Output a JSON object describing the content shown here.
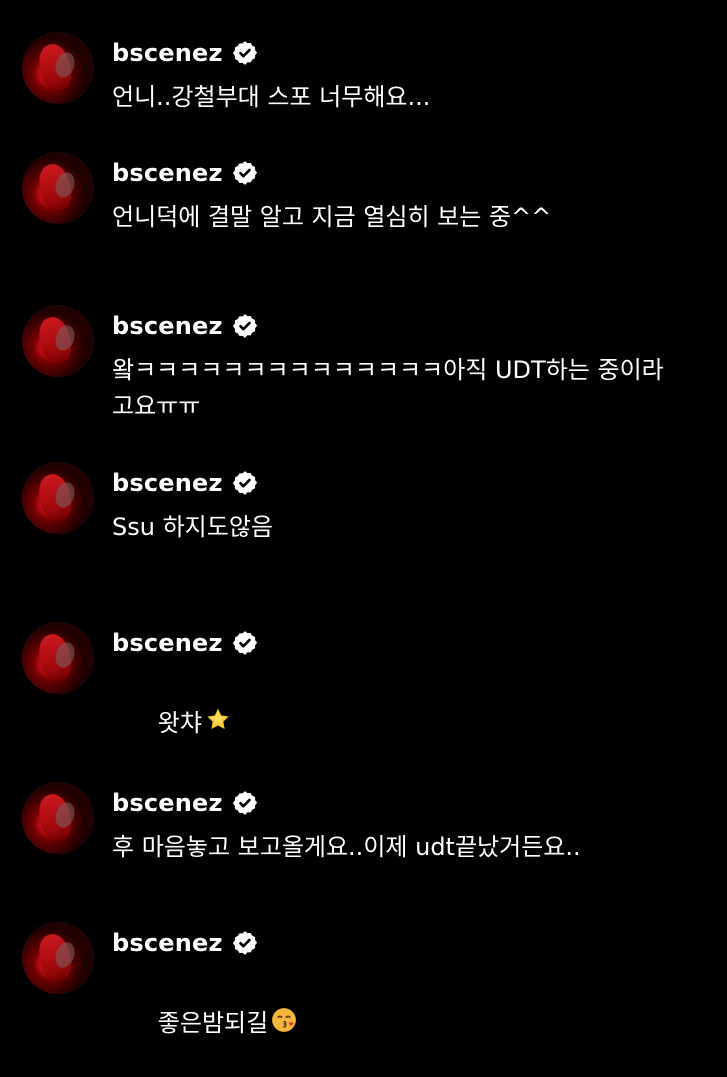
{
  "comments": [
    {
      "username": "bscenez",
      "text": "언니..강철부대 스포 너무해요..."
    },
    {
      "username": "bscenez",
      "text": "언니덕에 결말 알고 지금 열심히 보는 중^^"
    },
    {
      "username": "bscenez",
      "text": "왘ㅋㅋㅋㅋㅋㅋㅋㅋㅋㅋㅋㅋㅋㅋ아직 UDT하는 중이라고요ㅠㅠ"
    },
    {
      "username": "bscenez",
      "text": "Ssu 하지도않음"
    },
    {
      "username": "bscenez",
      "text": "왓챠",
      "emoji": "star-icon"
    },
    {
      "username": "bscenez",
      "text": "후 마음놓고 보고올게요..이제 udt끝났거든요.."
    },
    {
      "username": "bscenez",
      "text": "좋은밤되길",
      "emoji": "kiss-icon"
    }
  ],
  "colors": {
    "background": "#000000",
    "text": "#FFFFFF",
    "verified": "#FFFFFF",
    "star": "#F6C52B",
    "kiss_face": "#F3B53C",
    "kiss_heart": "#E53935"
  },
  "icons": {
    "verified": "verified-badge-icon",
    "avatar": "profile-avatar"
  }
}
